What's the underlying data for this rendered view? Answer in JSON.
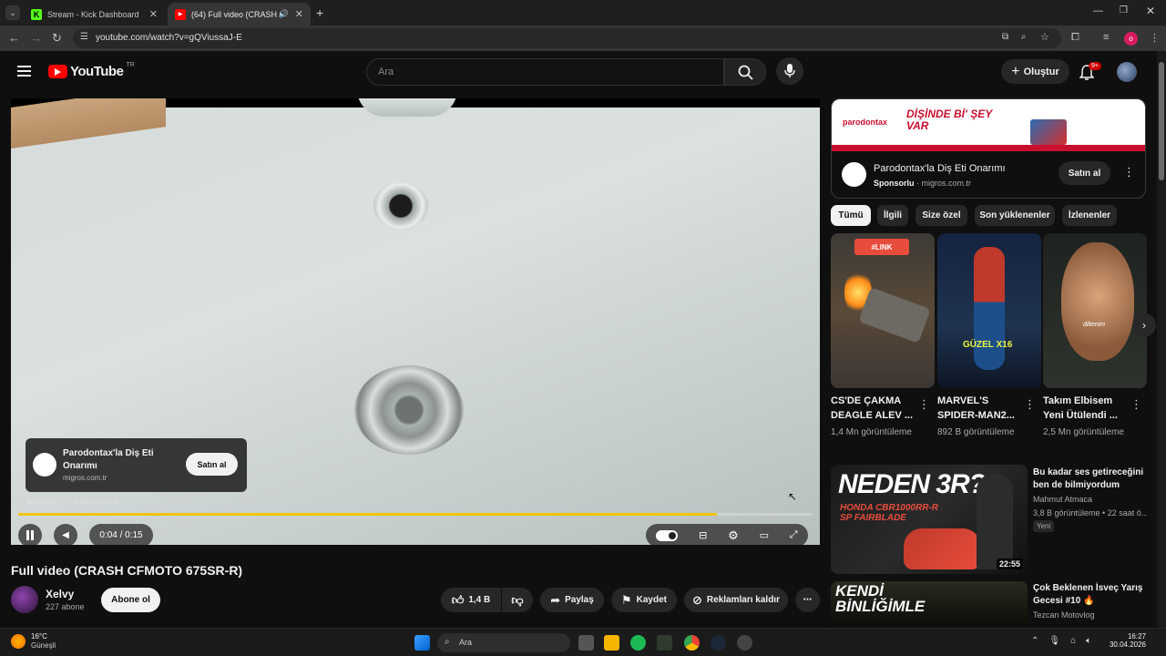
{
  "browser": {
    "tabs": [
      {
        "label": "Stream - Kick Dashboard",
        "favicon": "K",
        "favicon_color": "#53fc18",
        "active": false
      },
      {
        "label": "(64) Full video (CRASH CFM",
        "favicon": "▶",
        "favicon_color": "#ff0000",
        "active": true
      }
    ],
    "url": "youtube.com/watch?v=gQViussaJ-E",
    "profile_initial": "o"
  },
  "youtube": {
    "logo_text": "YouTube",
    "country_code": "TR",
    "search_placeholder": "Ara",
    "create_label": "Oluştur",
    "notification_count": "9+"
  },
  "player": {
    "ad": {
      "title": "Parodontax'la Diş Eti Onarımı",
      "domain": "migros.com.tr",
      "cta": "Satın al",
      "sponsored_label": "Sponsorlu",
      "sponsored_domain": "migros.com.tr"
    },
    "time": "0:04 / 0:15",
    "progress": 0.88
  },
  "video": {
    "title": "Full video (CRASH CFMOTO 675SR-R)",
    "channel": "Xelvy",
    "subscribers": "227 abone",
    "subscribe_label": "Abone ol",
    "likes": "1,4 B",
    "share_label": "Paylaş",
    "save_label": "Kaydet",
    "remove_ads_label": "Reklamları kaldır"
  },
  "sidebar": {
    "ad": {
      "banner_brand": "parodontax",
      "banner_headline": "DİŞİNDE Bİ' ŞEY VAR",
      "title": "Parodontax'la Diş Eti Onarımı",
      "sponsored": "Sponsorlu",
      "domain": "migros.com.tr",
      "cta": "Satın al"
    },
    "chips": [
      "Tümü",
      "İlgili",
      "Size özel",
      "Son yüklenenler",
      "İzlenenler"
    ],
    "shorts": [
      {
        "title": "CS'DE ÇAKMA DEAGLE ALEV ...",
        "views": "1,4 Mn görüntüleme",
        "overlay": "#LINK"
      },
      {
        "title": "MARVEL'S SPIDER-MAN2...",
        "views": "892 B görüntüleme",
        "overlay": "GÜZEL X16"
      },
      {
        "title": "Takım Elbisem Yeni Ütülendi ...",
        "views": "2,5 Mn görüntüleme",
        "overlay": "diltenim"
      }
    ],
    "videos": [
      {
        "title": "Bu kadar ses getireceğini ben de bilmiyordum",
        "channel": "Mahmut Atmaca",
        "meta": "3,8 B görüntüleme • 22 saat ö...",
        "badge": "Yeni",
        "duration": "22:55",
        "thumb_text": "NEDEN 3R?",
        "thumb_sub": "HONDA CBR1000RR-R SP FAIRBLADE"
      },
      {
        "title": "Çok Beklenen İsveç Yarış Gecesi #10 🔥",
        "channel": "Tezcan Motovlog",
        "meta": "",
        "badge": "",
        "duration": "",
        "thumb_text": "KENDİ BİNLİĞİMLE"
      }
    ]
  },
  "taskbar": {
    "weather_temp": "16°C",
    "weather_desc": "Güneşli",
    "search_label": "Ara",
    "time": "16:27",
    "date": "30.04.2026"
  }
}
